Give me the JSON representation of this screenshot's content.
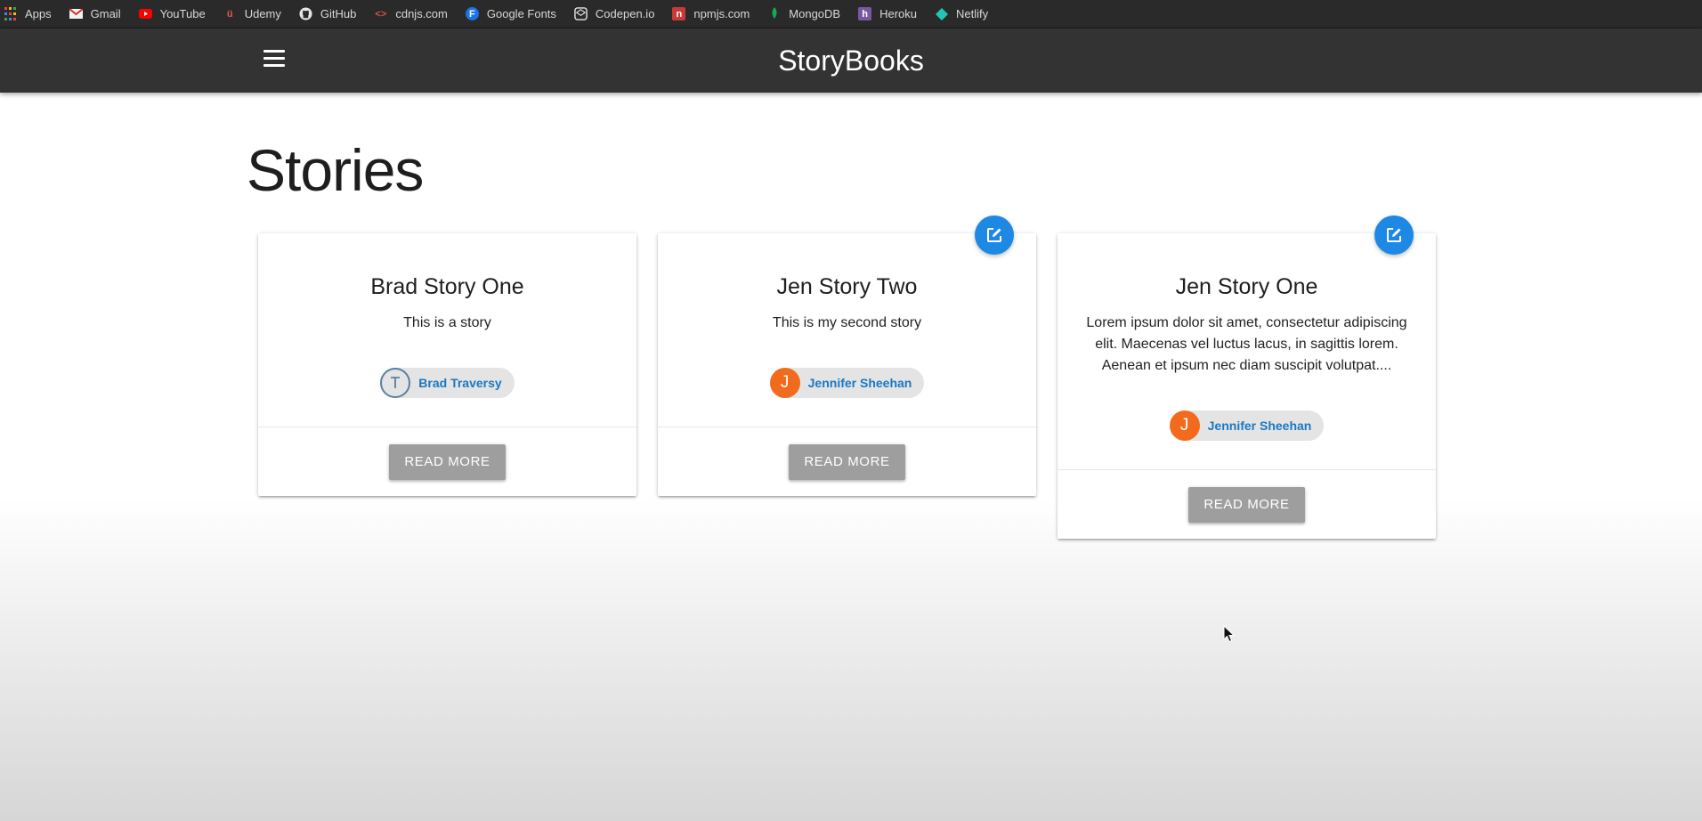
{
  "bookmarks": [
    {
      "label": "Apps",
      "icon": "apps-grid-icon",
      "color": "#4285f4"
    },
    {
      "label": "Gmail",
      "icon": "gmail-icon",
      "color": "#d93025"
    },
    {
      "label": "YouTube",
      "icon": "youtube-icon",
      "color": "#ff0000"
    },
    {
      "label": "Udemy",
      "icon": "udemy-icon",
      "color": "#ec5252"
    },
    {
      "label": "GitHub",
      "icon": "github-icon",
      "color": "#e0e0e0"
    },
    {
      "label": "cdnjs.com",
      "icon": "code-brackets-icon",
      "color": "#d9534f"
    },
    {
      "label": "Google Fonts",
      "icon": "google-fonts-icon",
      "color": "#1a73e8"
    },
    {
      "label": "Codepen.io",
      "icon": "codepen-icon",
      "color": "#e0e0e0"
    },
    {
      "label": "npmjs.com",
      "icon": "npm-icon",
      "color": "#cb3837"
    },
    {
      "label": "MongoDB",
      "icon": "mongodb-leaf-icon",
      "color": "#13aa52"
    },
    {
      "label": "Heroku",
      "icon": "heroku-icon",
      "color": "#79589f"
    },
    {
      "label": "Netlify",
      "icon": "netlify-icon",
      "color": "#20c6b7"
    }
  ],
  "navbar": {
    "brand": "StoryBooks",
    "background": "#333333"
  },
  "page": {
    "title": "Stories"
  },
  "stories": [
    {
      "title": "Brad Story One",
      "body": "This is a story",
      "author": "Brad Traversy",
      "avatar_type": "image",
      "avatar_letter": "",
      "editable": false,
      "read_more_label": "READ MORE"
    },
    {
      "title": "Jen Story Two",
      "body": "This is my second story",
      "author": "Jennifer Sheehan",
      "avatar_type": "letter",
      "avatar_letter": "J",
      "editable": true,
      "read_more_label": "READ MORE"
    },
    {
      "title": "Jen Story One",
      "body": "Lorem ipsum dolor sit amet, consectetur adipiscing elit. Maecenas vel luctus lacus, in sagittis lorem. Aenean et ipsum nec diam suscipit volutpat....",
      "author": "Jennifer Sheehan",
      "avatar_type": "letter",
      "avatar_letter": "J",
      "editable": true,
      "read_more_label": "READ MORE"
    }
  ],
  "colors": {
    "accent": "#1e88e5",
    "avatar_orange": "#f26b1d",
    "author_link": "#1a78c2",
    "button_grey": "#9e9e9e"
  }
}
